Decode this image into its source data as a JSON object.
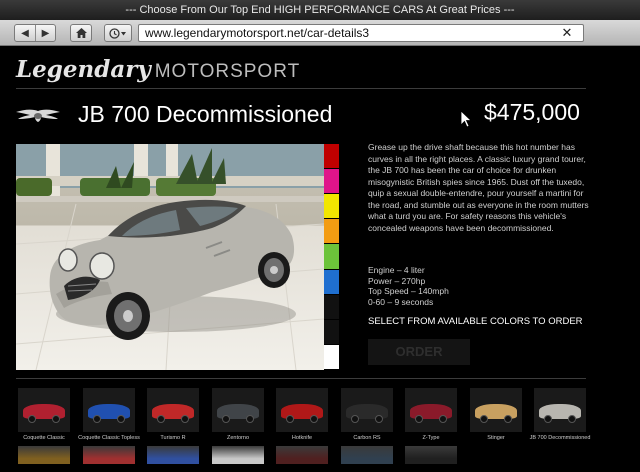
{
  "window": {
    "title": "--- Choose From Our Top End HIGH PERFORMANCE CARS At Great Prices ---"
  },
  "browser": {
    "url": "www.legendarymotorsport.net/car-details3",
    "back_icon": "back-arrow-icon",
    "forward_icon": "forward-arrow-icon",
    "home_icon": "home-icon",
    "history_icon": "history-clock-icon",
    "close_icon": "close-icon"
  },
  "site": {
    "logo_script": "Legendary",
    "logo_sans": "MOTORSPORT"
  },
  "car": {
    "badge_icon": "winged-emblem-icon",
    "name": "JB 700 Decommissioned",
    "price": "$475,000",
    "description": "Grease up the drive shaft because this hot number has curves in all the right places. A classic luxury grand tourer, the JB 700 has been the car of choice for drunken misogynistic British spies since 1965. Dust off the tuxedo, quip a sexual double-entendre, pour yourself a martini for the road, and stumble out as everyone in the room mutters what a turd you are. For safety reasons this vehicle's concealed weapons have been decommissioned.",
    "specs": [
      "Engine – 4 liter",
      "Power – 270hp",
      "Top Speed – 140mph",
      "0-60 – 9 seconds"
    ],
    "select_colors_label": "SELECT FROM AVAILABLE COLORS TO ORDER",
    "order_label": "ORDER",
    "colors": [
      "#c00000",
      "#e0148a",
      "#f2e600",
      "#f39c12",
      "#6cc33a",
      "#1f6fd0",
      "#111111",
      "#111111",
      "#ffffff"
    ]
  },
  "thumbnails": [
    {
      "label": "Coquette Classic",
      "color": "#b02030"
    },
    {
      "label": "Coquette Classic Topless",
      "color": "#2050b0"
    },
    {
      "label": "Turismo R",
      "color": "#c02828"
    },
    {
      "label": "Zentorno",
      "color": "#404448"
    },
    {
      "label": "Hotknife",
      "color": "#b01818"
    },
    {
      "label": "Carbon RS",
      "color": "#2a2a2a"
    },
    {
      "label": "Z-Type",
      "color": "#8a1a2a"
    },
    {
      "label": "Stinger",
      "color": "#c8a060"
    },
    {
      "label": "JB 700 Decommissioned",
      "color": "#b8b6b0"
    }
  ],
  "thumbnails_row2": [
    "#806020",
    "#a03030",
    "#3050a0",
    "#c8c8c8",
    "#502020",
    "#304050",
    "#202020"
  ]
}
